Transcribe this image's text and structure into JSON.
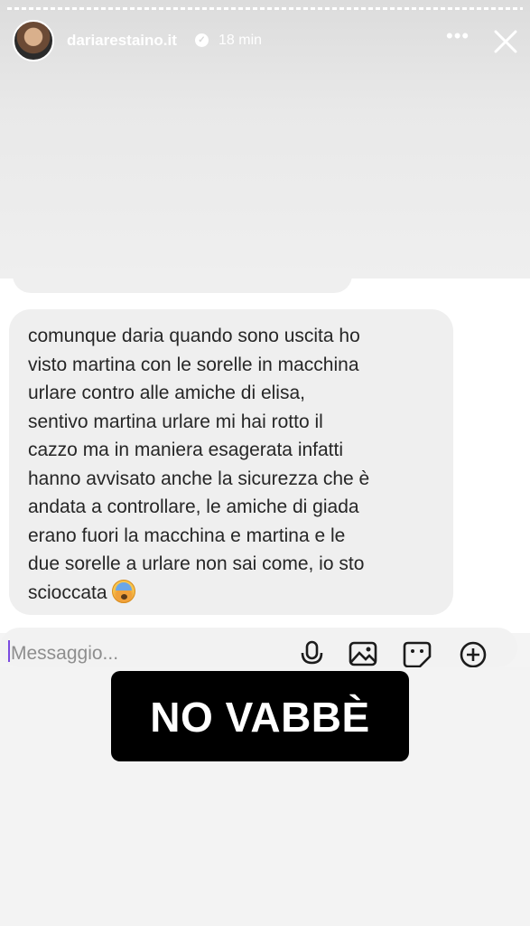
{
  "story": {
    "username": "dariarestaino.it",
    "time": "18 min",
    "progress_segments": 40,
    "verified_icon": "verified-badge-icon",
    "more_icon": "more-options-icon",
    "close_icon": "close-icon"
  },
  "chat": {
    "message": "comunque daria quando sono uscita ho\nvisto martina con le sorelle in macchina\nurlare contro alle amiche di elisa,\nsentivo martina urlare mi hai rotto il\ncazzo ma in maniera esagerata infatti\nhanno avvisato anche la sicurezza che è\nandata a controllare, le amiche di giada\nerano fuori la macchina e martina e le\ndue sorelle a urlare non sai come, io sto\nscioccata",
    "emoji": "fearful-face-emoji"
  },
  "composer": {
    "placeholder": "Messaggio...",
    "icons": [
      "microphone-icon",
      "gallery-icon",
      "sticker-icon",
      "plus-icon"
    ]
  },
  "overlay": {
    "label": "NO VABBÈ"
  },
  "colors": {
    "caret": "#7b4be0",
    "bubble": "#efefef",
    "label_bg": "#000000",
    "label_text": "#ffffff"
  }
}
